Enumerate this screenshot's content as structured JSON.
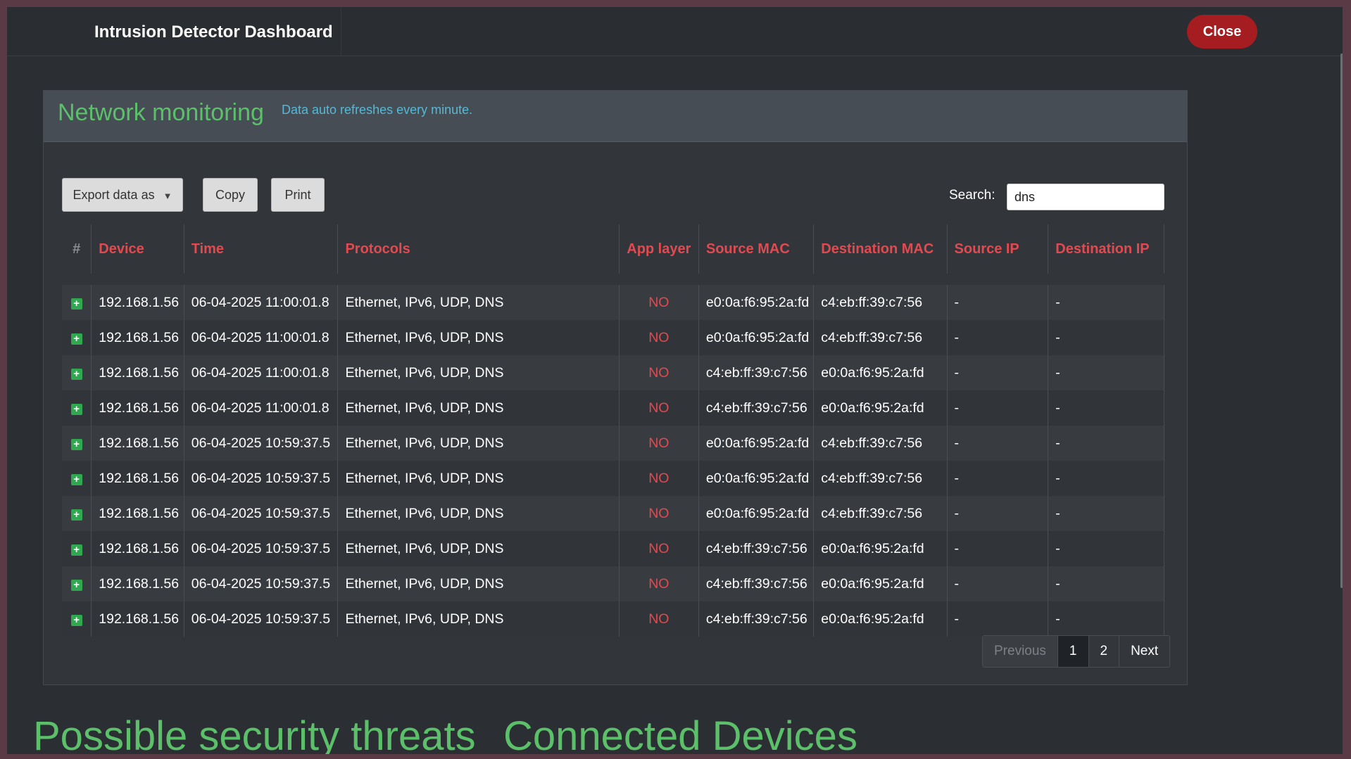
{
  "app": {
    "title": "Intrusion Detector Dashboard",
    "close_label": "Close"
  },
  "panel": {
    "title": "Network monitoring",
    "subtitle": "Data auto refreshes every minute.",
    "toolbar": {
      "export_label": "Export data as",
      "copy_label": "Copy",
      "print_label": "Print"
    },
    "search": {
      "label": "Search:",
      "value": "dns"
    },
    "table": {
      "headers": [
        "#",
        "Device",
        "Time",
        "Protocols",
        "App layer",
        "Source MAC",
        "Destination MAC",
        "Source IP",
        "Destination IP"
      ],
      "rows": [
        {
          "device": "192.168.1.56",
          "time": "06-04-2025 11:00:01.8",
          "protocols": "Ethernet, IPv6, UDP, DNS",
          "app_layer": "NO",
          "src_mac": "e0:0a:f6:95:2a:fd",
          "dst_mac": "c4:eb:ff:39:c7:56",
          "src_ip": "-",
          "dst_ip": "-"
        },
        {
          "device": "192.168.1.56",
          "time": "06-04-2025 11:00:01.8",
          "protocols": "Ethernet, IPv6, UDP, DNS",
          "app_layer": "NO",
          "src_mac": "e0:0a:f6:95:2a:fd",
          "dst_mac": "c4:eb:ff:39:c7:56",
          "src_ip": "-",
          "dst_ip": "-"
        },
        {
          "device": "192.168.1.56",
          "time": "06-04-2025 11:00:01.8",
          "protocols": "Ethernet, IPv6, UDP, DNS",
          "app_layer": "NO",
          "src_mac": "c4:eb:ff:39:c7:56",
          "dst_mac": "e0:0a:f6:95:2a:fd",
          "src_ip": "-",
          "dst_ip": "-"
        },
        {
          "device": "192.168.1.56",
          "time": "06-04-2025 11:00:01.8",
          "protocols": "Ethernet, IPv6, UDP, DNS",
          "app_layer": "NO",
          "src_mac": "c4:eb:ff:39:c7:56",
          "dst_mac": "e0:0a:f6:95:2a:fd",
          "src_ip": "-",
          "dst_ip": "-"
        },
        {
          "device": "192.168.1.56",
          "time": "06-04-2025 10:59:37.5",
          "protocols": "Ethernet, IPv6, UDP, DNS",
          "app_layer": "NO",
          "src_mac": "e0:0a:f6:95:2a:fd",
          "dst_mac": "c4:eb:ff:39:c7:56",
          "src_ip": "-",
          "dst_ip": "-"
        },
        {
          "device": "192.168.1.56",
          "time": "06-04-2025 10:59:37.5",
          "protocols": "Ethernet, IPv6, UDP, DNS",
          "app_layer": "NO",
          "src_mac": "e0:0a:f6:95:2a:fd",
          "dst_mac": "c4:eb:ff:39:c7:56",
          "src_ip": "-",
          "dst_ip": "-"
        },
        {
          "device": "192.168.1.56",
          "time": "06-04-2025 10:59:37.5",
          "protocols": "Ethernet, IPv6, UDP, DNS",
          "app_layer": "NO",
          "src_mac": "e0:0a:f6:95:2a:fd",
          "dst_mac": "c4:eb:ff:39:c7:56",
          "src_ip": "-",
          "dst_ip": "-"
        },
        {
          "device": "192.168.1.56",
          "time": "06-04-2025 10:59:37.5",
          "protocols": "Ethernet, IPv6, UDP, DNS",
          "app_layer": "NO",
          "src_mac": "c4:eb:ff:39:c7:56",
          "dst_mac": "e0:0a:f6:95:2a:fd",
          "src_ip": "-",
          "dst_ip": "-"
        },
        {
          "device": "192.168.1.56",
          "time": "06-04-2025 10:59:37.5",
          "protocols": "Ethernet, IPv6, UDP, DNS",
          "app_layer": "NO",
          "src_mac": "c4:eb:ff:39:c7:56",
          "dst_mac": "e0:0a:f6:95:2a:fd",
          "src_ip": "-",
          "dst_ip": "-"
        },
        {
          "device": "192.168.1.56",
          "time": "06-04-2025 10:59:37.5",
          "protocols": "Ethernet, IPv6, UDP, DNS",
          "app_layer": "NO",
          "src_mac": "c4:eb:ff:39:c7:56",
          "dst_mac": "e0:0a:f6:95:2a:fd",
          "src_ip": "-",
          "dst_ip": "-"
        }
      ]
    },
    "pagination": {
      "previous_label": "Previous",
      "pages": [
        "1",
        "2"
      ],
      "active_page": "1",
      "next_label": "Next"
    }
  },
  "sections": {
    "threats_title": "Possible security threats",
    "devices_title": "Connected Devices"
  },
  "colors": {
    "accent_green": "#5cc06a",
    "header_red": "#e14a50",
    "close_red": "#a51d21",
    "info_blue": "#55b9d6"
  },
  "icons": {
    "row_expand": "plus-square-icon",
    "dropdown": "caret-down-icon"
  }
}
